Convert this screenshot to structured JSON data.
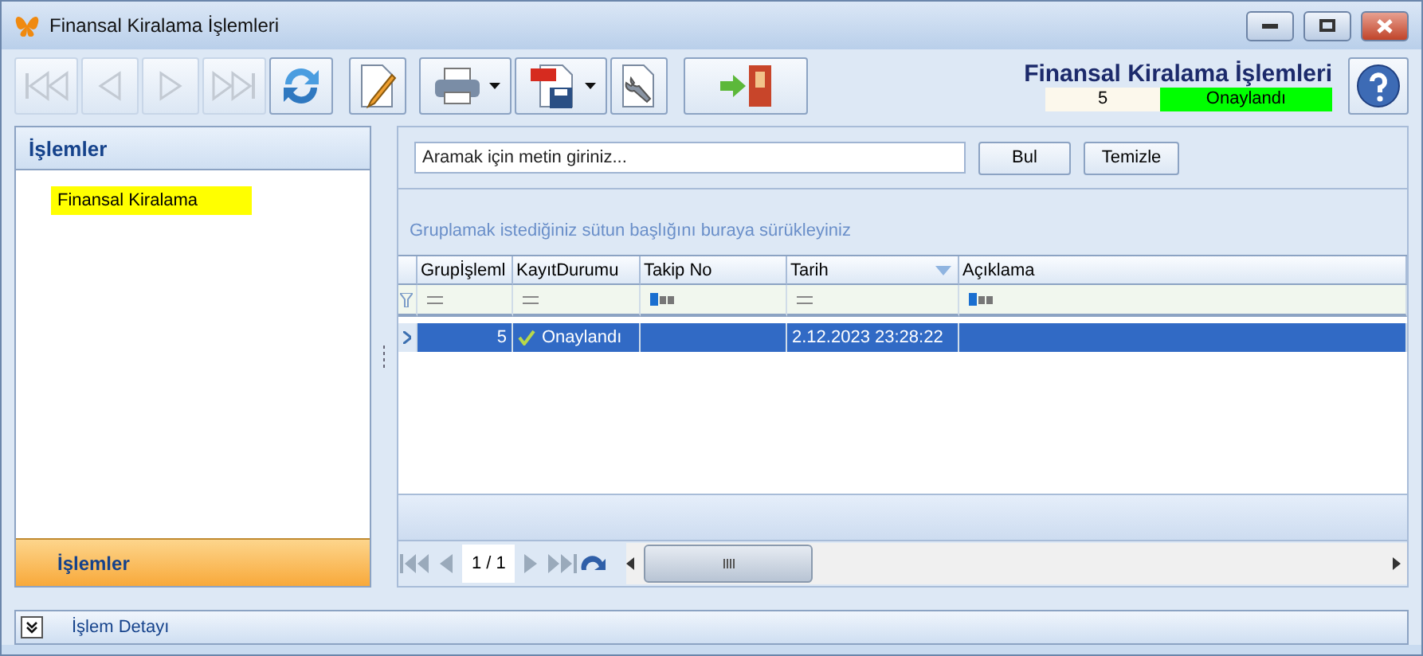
{
  "window": {
    "title": "Finansal Kiralama İşlemleri"
  },
  "toolbar": {
    "buttons": [
      {
        "kind": "first",
        "disabled": true,
        "dropdown": false
      },
      {
        "kind": "prev",
        "disabled": true,
        "dropdown": false
      },
      {
        "kind": "next",
        "disabled": true,
        "dropdown": false
      },
      {
        "kind": "last",
        "disabled": true,
        "dropdown": false
      },
      {
        "kind": "refresh",
        "disabled": false,
        "dropdown": false
      },
      {
        "kind": "edit",
        "disabled": false,
        "dropdown": false
      },
      {
        "kind": "print",
        "disabled": false,
        "dropdown": true
      },
      {
        "kind": "pdf",
        "disabled": false,
        "dropdown": true
      },
      {
        "kind": "settings",
        "disabled": false,
        "dropdown": false
      },
      {
        "kind": "exit",
        "disabled": false,
        "dropdown": false
      }
    ]
  },
  "header": {
    "title": "Finansal Kiralama İşlemleri",
    "record_number": "5",
    "status": "Onaylandı"
  },
  "sidebar": {
    "title": "İşlemler",
    "items": [
      {
        "label": "Finansal Kiralama",
        "selected": true
      }
    ],
    "footer_button": "İşlemler"
  },
  "search": {
    "placeholder": "Aramak için metin giriniz...",
    "buttons": [
      "Bul",
      "Temizle"
    ]
  },
  "group_panel": {
    "hint": "Gruplamak istediğiniz sütun başlığını buraya sürükleyiniz"
  },
  "table": {
    "columns": [
      {
        "label": "Grupİşleml",
        "sorted": false,
        "text_filter": false
      },
      {
        "label": "KayıtDurumu",
        "sorted": false,
        "text_filter": false
      },
      {
        "label": "Takip No",
        "sorted": false,
        "text_filter": true
      },
      {
        "label": "Tarih",
        "sorted": true,
        "text_filter": false
      },
      {
        "label": "Açıklama",
        "sorted": false,
        "text_filter": true
      }
    ],
    "rows": [
      {
        "selected": true,
        "approved": true,
        "cells": [
          "5",
          "Onaylandı",
          "",
          "2.12.2023 23:28:22",
          ""
        ]
      }
    ]
  },
  "pager": {
    "page": "1 / 1"
  },
  "detail": {
    "label": "İşlem Detayı",
    "expanded": false
  }
}
